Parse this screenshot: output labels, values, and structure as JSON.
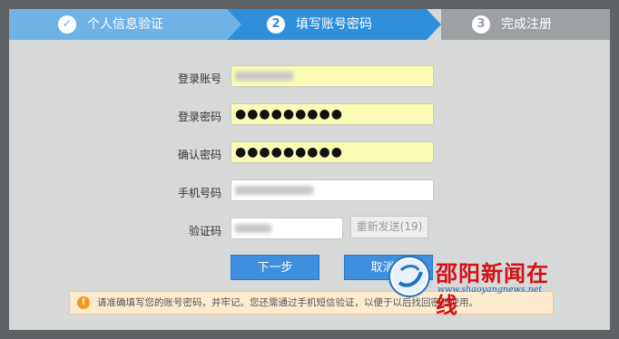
{
  "steps": [
    {
      "number": "✓",
      "label": "个人信息验证"
    },
    {
      "number": "2",
      "label": "填写账号密码"
    },
    {
      "number": "3",
      "label": "完成注册"
    }
  ],
  "form": {
    "account_label": "登录账号",
    "password_label": "登录密码",
    "confirm_label": "确认密码",
    "phone_label": "手机号码",
    "code_label": "验证码",
    "password_value": "●●●●●●●●●",
    "confirm_value": "●●●●●●●●●",
    "resend_label": "重新发送(19)"
  },
  "buttons": {
    "next_label": "下一步",
    "cancel_label": "取消注"
  },
  "notice": {
    "icon": "!",
    "text": "请准确填写您的账号密码，并牢记。您还需通过手机短信验证，以便于以后找回密码使用。"
  },
  "watermark": {
    "name": "邵阳新闻在线",
    "url": "www.shaoyangnews.net"
  },
  "colors": {
    "active_step": "#2f8fdb",
    "done_step": "#6fb3e6",
    "pending_step": "#9ea1a4",
    "field_highlight": "#fafcb3",
    "primary_button": "#3e8fde"
  }
}
